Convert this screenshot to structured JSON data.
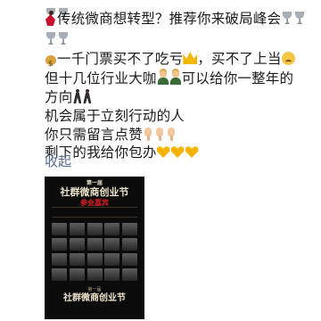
{
  "post": {
    "lines": [
      "传统微商想转型？推荐你来破局峰会",
      "一千门票买不了吃亏",
      "，买不了上当",
      "但十几位行业大咖",
      "可以给你一整年的",
      "方向",
      "机会属于立刻行动的人",
      "你只需留言点赞",
      "剩下的我给你包办"
    ],
    "collapse_label": "收起",
    "icons": [
      "trophy-icon",
      "dancer-icon",
      "money-bag-icon",
      "crown-icon",
      "face-icon",
      "person-icon",
      "walking-icon",
      "pointing-hand-icon",
      "yellow-heart-icon"
    ]
  },
  "poster": {
    "top_small": "第一届",
    "top_title": "社群微商创业节",
    "top_sub": "参会嘉宾",
    "bottom_small": "第一届",
    "bottom_title": "社群微商创业节"
  }
}
